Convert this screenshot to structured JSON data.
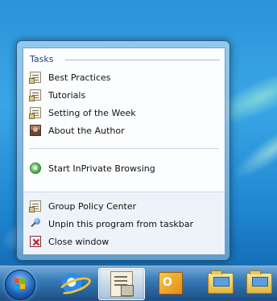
{
  "jumplist": {
    "section_title": "Tasks",
    "tasks": [
      {
        "label": "Best Practices",
        "icon": "document-icon"
      },
      {
        "label": "Tutorials",
        "icon": "document-icon"
      },
      {
        "label": "Setting of the Week",
        "icon": "document-icon"
      },
      {
        "label": "About the Author",
        "icon": "author-photo-icon"
      }
    ],
    "inprivate": {
      "label": "Start InPrivate Browsing",
      "icon": "inprivate-icon"
    },
    "app_actions": [
      {
        "label": "Group Policy Center",
        "icon": "document-icon"
      },
      {
        "label": "Unpin this program from taskbar",
        "icon": "unpin-icon"
      },
      {
        "label": "Close window",
        "icon": "close-window-icon"
      }
    ]
  },
  "taskbar": {
    "buttons": [
      {
        "name": "start-orb",
        "icon": "windows-flag-icon"
      },
      {
        "name": "internet-explorer",
        "icon": "internet-explorer-icon"
      },
      {
        "name": "group-policy-center",
        "icon": "group-policy-icon",
        "active": true
      },
      {
        "name": "outlook",
        "icon": "outlook-icon"
      },
      {
        "name": "windows-explorer",
        "icon": "folder-icon"
      },
      {
        "name": "documents",
        "icon": "folder-icon"
      }
    ]
  },
  "colors": {
    "accent": "#1d3e8c",
    "wallpaper": "#2b93d9",
    "taskbar": "#1e4b7d"
  }
}
